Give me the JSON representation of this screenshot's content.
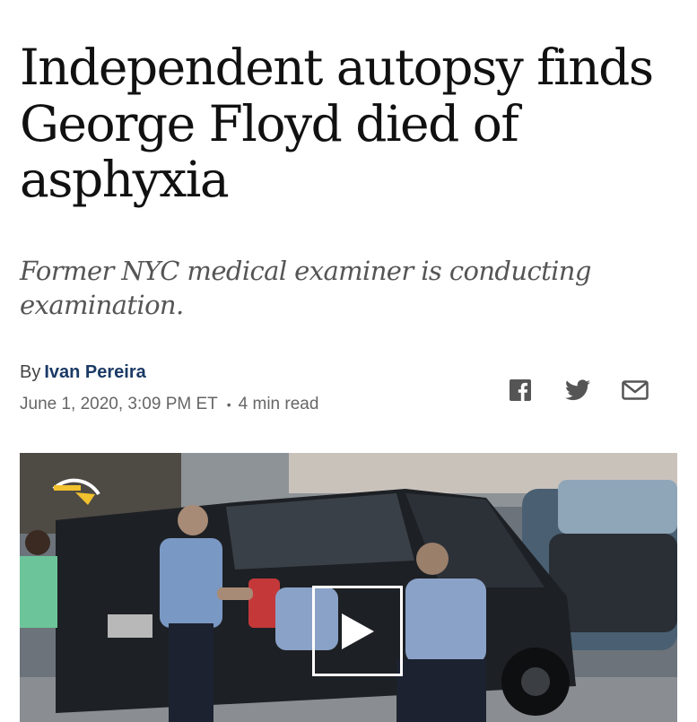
{
  "article": {
    "headline": "Independent autopsy finds George Floyd died of asphyxia",
    "subheadline": "Former NYC medical examiner is conducting examination.",
    "byline_prefix": "By",
    "author": "Ivan Pereira",
    "date": "June 1, 2020, 3:09 PM ET",
    "read_time": "4 min read"
  },
  "share": {
    "icons": [
      "facebook-icon",
      "twitter-icon",
      "email-icon"
    ]
  },
  "video": {
    "play_icon": "play-icon"
  },
  "colors": {
    "headline": "#111111",
    "subheadline": "#555555",
    "author_link": "#1b3a66",
    "icon_gray": "#555555"
  }
}
